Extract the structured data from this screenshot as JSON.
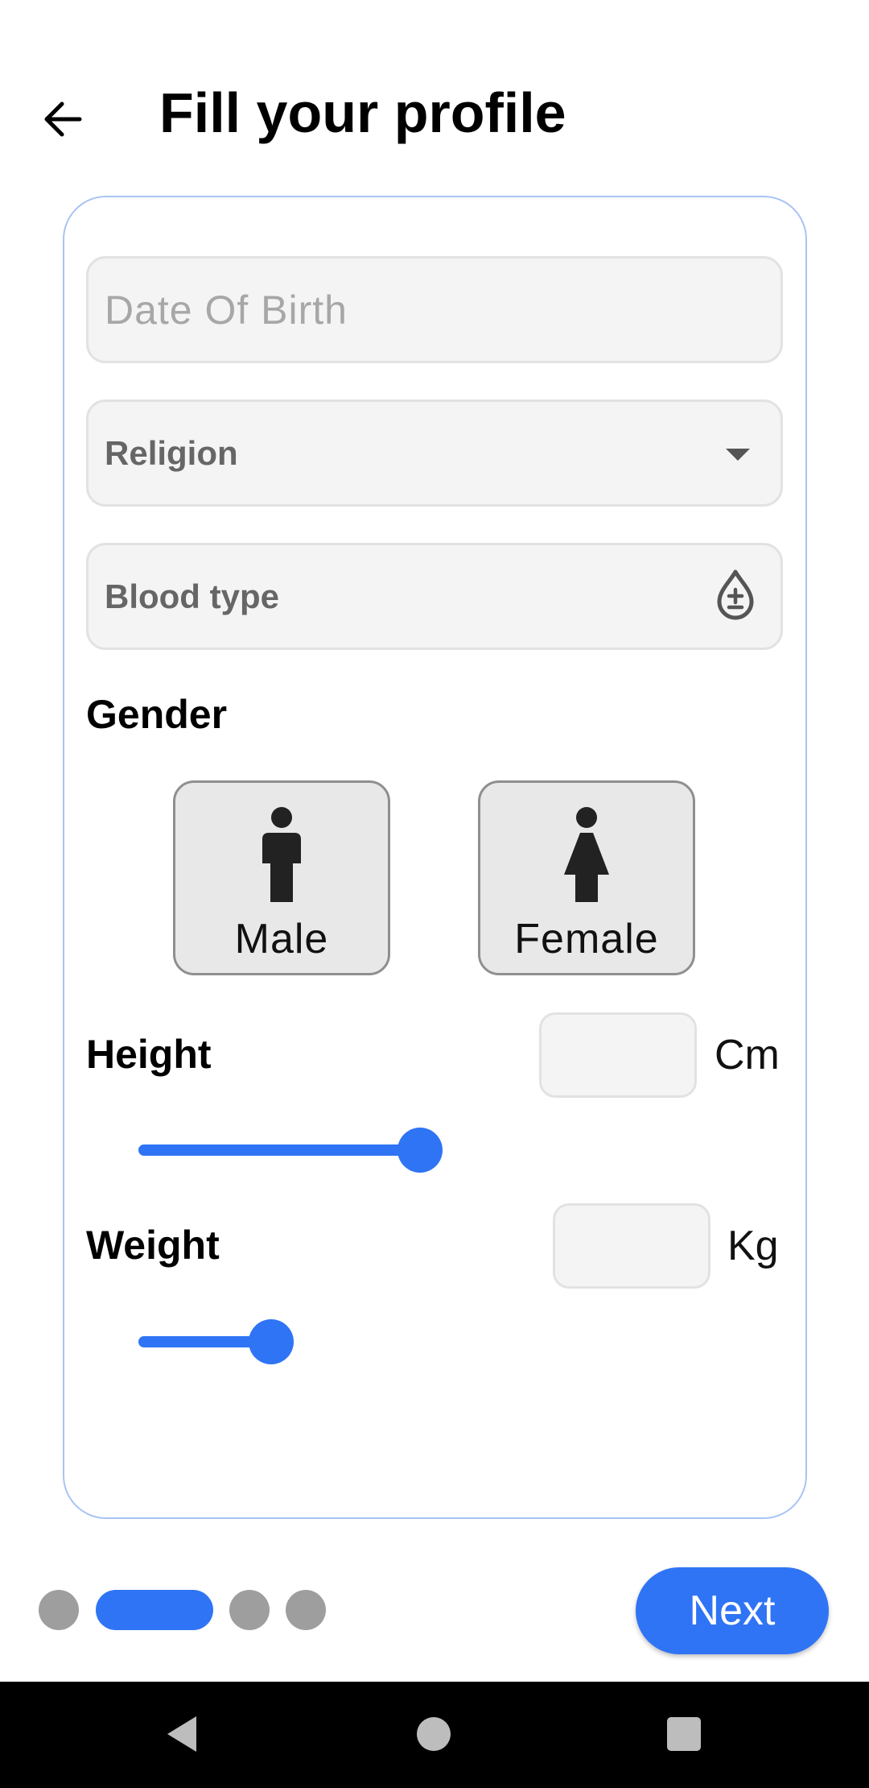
{
  "header": {
    "title": "Fill your profile",
    "back_icon": "arrow-left-icon"
  },
  "form": {
    "date_of_birth": {
      "placeholder": "Date Of Birth",
      "value": ""
    },
    "religion": {
      "label": "Religion",
      "icon": "dropdown-arrow-icon"
    },
    "blood_type": {
      "label": "Blood type",
      "icon": "blood-drop-plus-minus-icon"
    },
    "gender": {
      "label": "Gender",
      "options": [
        {
          "label": "Male",
          "icon": "male-person-icon"
        },
        {
          "label": "Female",
          "icon": "female-person-icon"
        }
      ]
    },
    "height": {
      "label": "Height",
      "value": "",
      "unit": "Cm",
      "slider_level": 0.7
    },
    "weight": {
      "label": "Weight",
      "value": "",
      "unit": "Kg",
      "slider_level": 0.33
    }
  },
  "pager": {
    "count": 4,
    "active_index": 1
  },
  "footer": {
    "next_label": "Next"
  },
  "colors": {
    "accent": "#2f74f5",
    "field_bg": "#f4f4f4",
    "card_border": "#a9c3f5",
    "dot_inactive": "#9e9e9e"
  },
  "system_nav": {
    "icons": [
      "nav-back-icon",
      "nav-home-icon",
      "nav-recent-icon"
    ]
  }
}
